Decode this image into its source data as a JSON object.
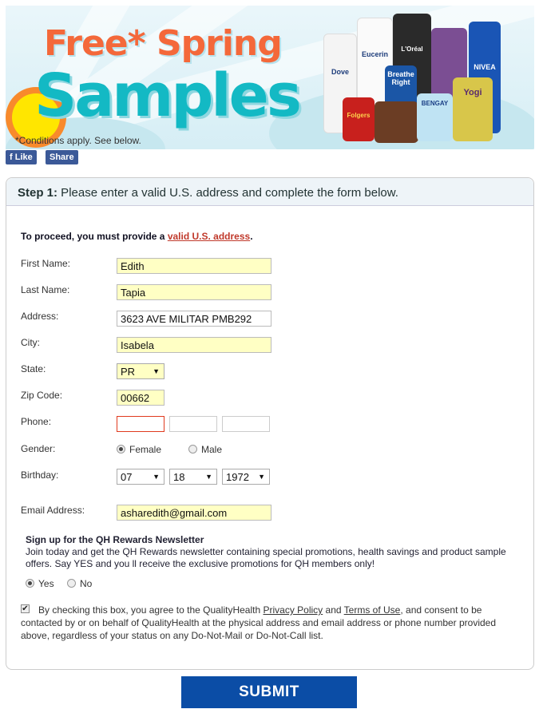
{
  "banner": {
    "title_line1": "Free* Spring",
    "title_line2": "Samples",
    "conditions": "*Conditions apply. See below.",
    "product_brands": [
      "Dove",
      "Eucerin",
      "L'Oréal",
      "Breathe Right",
      "NIVEA",
      "Folgers",
      "BENGAY",
      "Yogi"
    ]
  },
  "social": {
    "like": "Like",
    "share": "Share"
  },
  "form": {
    "step_label": "Step 1:",
    "step_text": " Please enter a valid U.S. address and complete the form below.",
    "intro": "To proceed, you must provide a ",
    "intro_link": "valid U.S. address",
    "intro_end": ".",
    "fields": {
      "first_name": {
        "label": "First Name:",
        "value": "Edith"
      },
      "last_name": {
        "label": "Last Name:",
        "value": "Tapia"
      },
      "address": {
        "label": "Address:",
        "value": "3623 AVE MILITAR PMB292"
      },
      "city": {
        "label": "City:",
        "value": "Isabela"
      },
      "state": {
        "label": "State:",
        "value": "PR"
      },
      "zip": {
        "label": "Zip Code:",
        "value": "00662"
      },
      "phone": {
        "label": "Phone:",
        "values": [
          "",
          "",
          ""
        ]
      },
      "gender": {
        "label": "Gender:",
        "options": [
          "Female",
          "Male"
        ],
        "selected": "Female"
      },
      "birthday": {
        "label": "Birthday:",
        "month": "07",
        "day": "18",
        "year": "1972"
      },
      "email": {
        "label": "Email Address:",
        "value": "asharedith@gmail.com"
      }
    },
    "newsletter": {
      "title": "Sign up for the QH Rewards Newsletter",
      "text": "Join today and get the QH Rewards newsletter containing special promotions, health savings and product sample offers. Say YES and you ll receive the exclusive promotions for QH members only!",
      "options": [
        "Yes",
        "No"
      ],
      "selected": "Yes"
    },
    "consent": {
      "checked": true,
      "t1": "By checking this box, you agree to the QualityHealth ",
      "privacy": "Privacy Policy",
      "t2": " and ",
      "terms": "Terms of Use",
      "t3": ", and consent to be contacted by or on behalf of QualityHealth at the physical address and email address or phone number provided above, regardless of your status on any Do-Not-Mail or Do-Not-Call list."
    },
    "submit": "SUBMIT"
  },
  "colors": {
    "submit": "#0b4da6",
    "link": "#c0392b",
    "field_highlight": "#ffffc4",
    "error_border": "#e03a1e"
  }
}
